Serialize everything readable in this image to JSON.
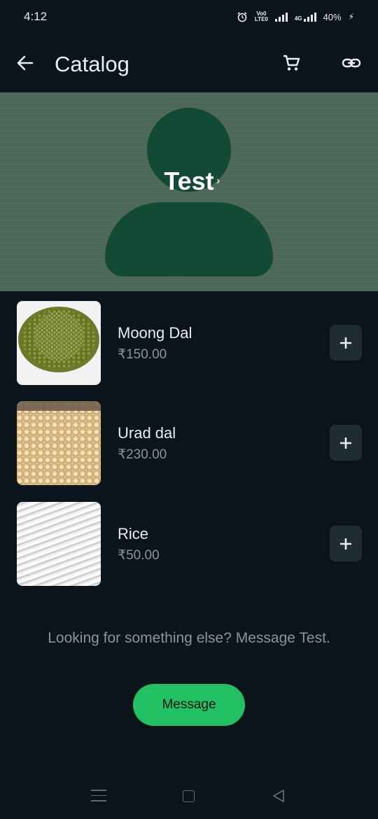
{
  "status_bar": {
    "time": "4:12",
    "network_label_top": "Vo0",
    "network_label_bottom": "LTE0",
    "network_type": "4G",
    "battery": "40%"
  },
  "app_bar": {
    "title": "Catalog",
    "icons": [
      "back-arrow-icon",
      "cart-icon",
      "link-icon"
    ]
  },
  "business": {
    "name": "Test",
    "chevron": "›"
  },
  "products": [
    {
      "name": "Moong Dal",
      "price": "₹150.00",
      "add_label": "+"
    },
    {
      "name": "Urad dal",
      "price": "₹230.00",
      "add_label": "+"
    },
    {
      "name": "Rice",
      "price": "₹50.00",
      "add_label": "+"
    }
  ],
  "footer": {
    "looking_text": "Looking for something else? Message Test.",
    "message_button": "Message"
  },
  "colors": {
    "background": "#0b141a",
    "banner": "#4d6859",
    "avatar": "#134a36",
    "accent": "#21c063",
    "secondary_text": "#8696a0"
  }
}
